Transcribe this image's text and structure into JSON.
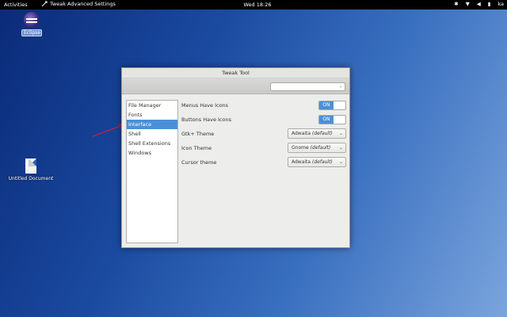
{
  "topbar": {
    "activities": "Activities",
    "app_name": "Tweak Advanced Settings",
    "clock": "Wed 18:26",
    "user": "ka"
  },
  "desktop": {
    "eclipse_label": "Eclipse",
    "document_label": "Untitled Document"
  },
  "window": {
    "title": "Tweak Tool",
    "search_placeholder": "",
    "sidebar": {
      "items": [
        {
          "label": "File Manager"
        },
        {
          "label": "Fonts"
        },
        {
          "label": "Interface"
        },
        {
          "label": "Shell"
        },
        {
          "label": "Shell Extensions"
        },
        {
          "label": "Windows"
        }
      ],
      "selected": "Interface"
    },
    "settings": {
      "menus_icons": {
        "label": "Menus Have Icons",
        "state": "ON"
      },
      "buttons_icons": {
        "label": "Buttons Have Icons",
        "state": "ON"
      },
      "gtk_theme": {
        "label": "Gtk+ Theme",
        "name": "Adwaita",
        "suffix": "(default)"
      },
      "icon_theme": {
        "label": "Icon Theme",
        "name": "Gnome",
        "suffix": "(default)"
      },
      "cursor_theme": {
        "label": "Cursor theme",
        "name": "Adwaita",
        "suffix": "(default)"
      }
    }
  },
  "colors": {
    "accent": "#4a90d9",
    "annotation_arrow": "#d8203a"
  }
}
